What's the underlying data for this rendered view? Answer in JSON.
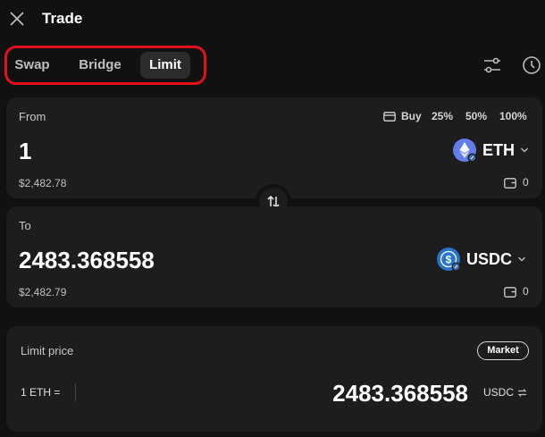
{
  "header": {
    "title": "Trade"
  },
  "tabs": [
    {
      "label": "Swap",
      "active": false
    },
    {
      "label": "Bridge",
      "active": false
    },
    {
      "label": "Limit",
      "active": true
    }
  ],
  "from": {
    "label": "From",
    "quick": {
      "buy": "Buy",
      "p25": "25%",
      "p50": "50%",
      "p100": "100%"
    },
    "amount": "1",
    "usd_value": "$2,482.78",
    "token": {
      "symbol": "ETH",
      "icon": "eth-icon",
      "color": "#627eea"
    },
    "balance": "0"
  },
  "to": {
    "label": "To",
    "amount": "2483.368558",
    "usd_value": "$2,482.79",
    "token": {
      "symbol": "USDC",
      "icon": "usdc-icon",
      "color": "#2775ca"
    },
    "balance": "0"
  },
  "limit": {
    "label": "Limit price",
    "market_label": "Market",
    "base": "1 ETH =",
    "price": "2483.368558",
    "quote": "USDC"
  },
  "colors": {
    "highlight": "#e3101a",
    "background": "#111111",
    "card": "#1d1d1d"
  }
}
